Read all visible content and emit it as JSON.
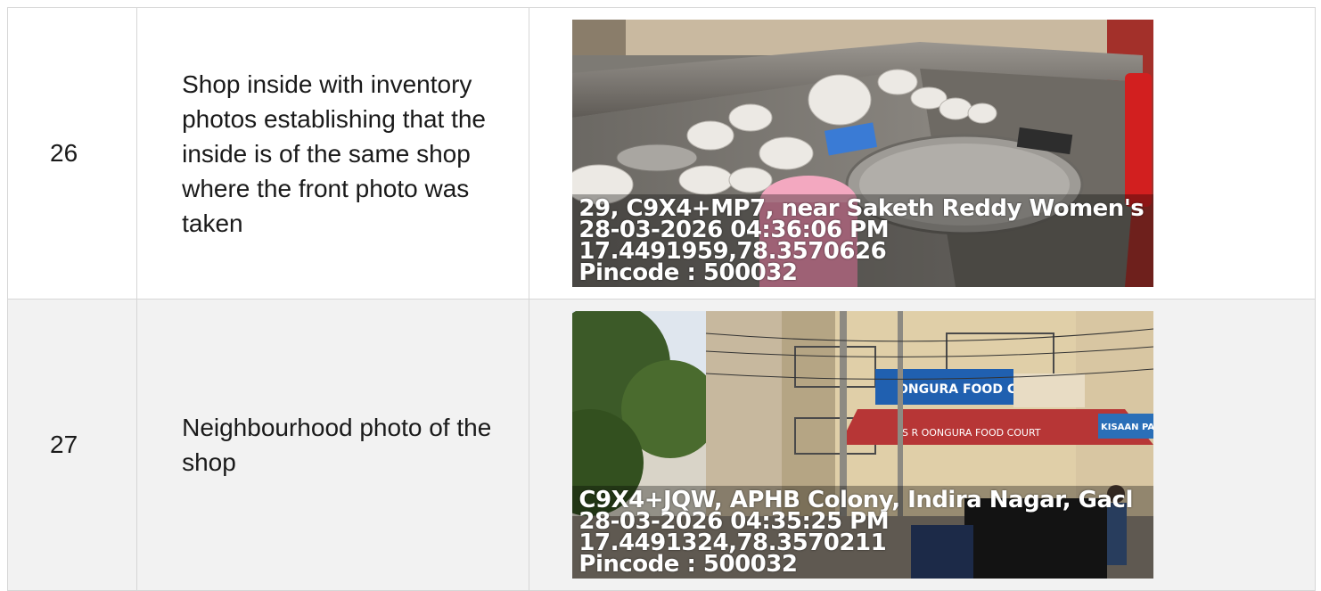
{
  "rows": [
    {
      "sno": "26",
      "description": "Shop inside with inventory photos establishing that the inside is of the same shop where the front photo was taken",
      "photo": {
        "subject": "shop-interior",
        "stamp": {
          "address": "29, C9X4+MP7, near Saketh Reddy Women's",
          "datetime": "28-03-2026 04:36:06 PM",
          "coords": "17.4491959,78.3570626",
          "pincode": "Pincode : 500032"
        }
      }
    },
    {
      "sno": "27",
      "description": "Neighbourhood photo of the shop",
      "photo": {
        "subject": "street-view",
        "signs": {
          "shop_sign": "ONGURA FOOD COURT",
          "awning": "S R OONGURA FOOD COURT",
          "right_sign": "KISAAN PARI"
        },
        "stamp": {
          "address": "C9X4+JQW, APHB Colony, Indira Nagar, Gacl",
          "datetime": "28-03-2026 04:35:25 PM",
          "coords": "17.4491324,78.3570211",
          "pincode": "Pincode : 500032"
        }
      }
    }
  ]
}
